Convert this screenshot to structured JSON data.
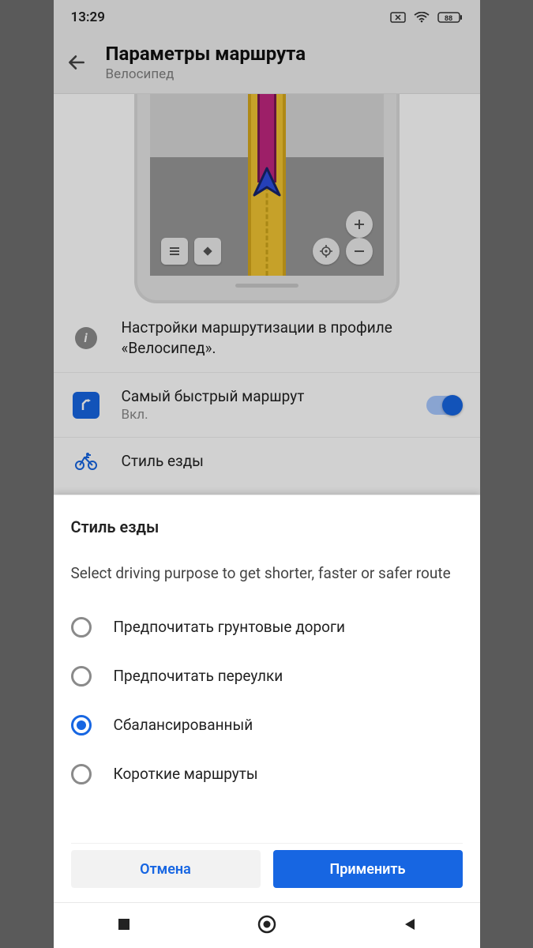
{
  "statusbar": {
    "time": "13:29",
    "battery": "88"
  },
  "header": {
    "title": "Параметры маршрута",
    "subtitle": "Велосипед"
  },
  "info_text": "Настройки маршрутизации в профиле «Велосипед».",
  "fastest_route": {
    "label": "Самый быстрый маршрут",
    "status": "Вкл."
  },
  "driving_style_row": {
    "label": "Стиль езды"
  },
  "dialog": {
    "title": "Стиль езды",
    "description": "Select driving purpose to get shorter, faster or safer route",
    "options": [
      {
        "label": "Предпочитать грунтовые дороги",
        "selected": false
      },
      {
        "label": "Предпочитать переулки",
        "selected": false
      },
      {
        "label": "Сбалансированный",
        "selected": true
      },
      {
        "label": "Короткие маршруты",
        "selected": false
      }
    ],
    "cancel": "Отмена",
    "apply": "Применить"
  }
}
